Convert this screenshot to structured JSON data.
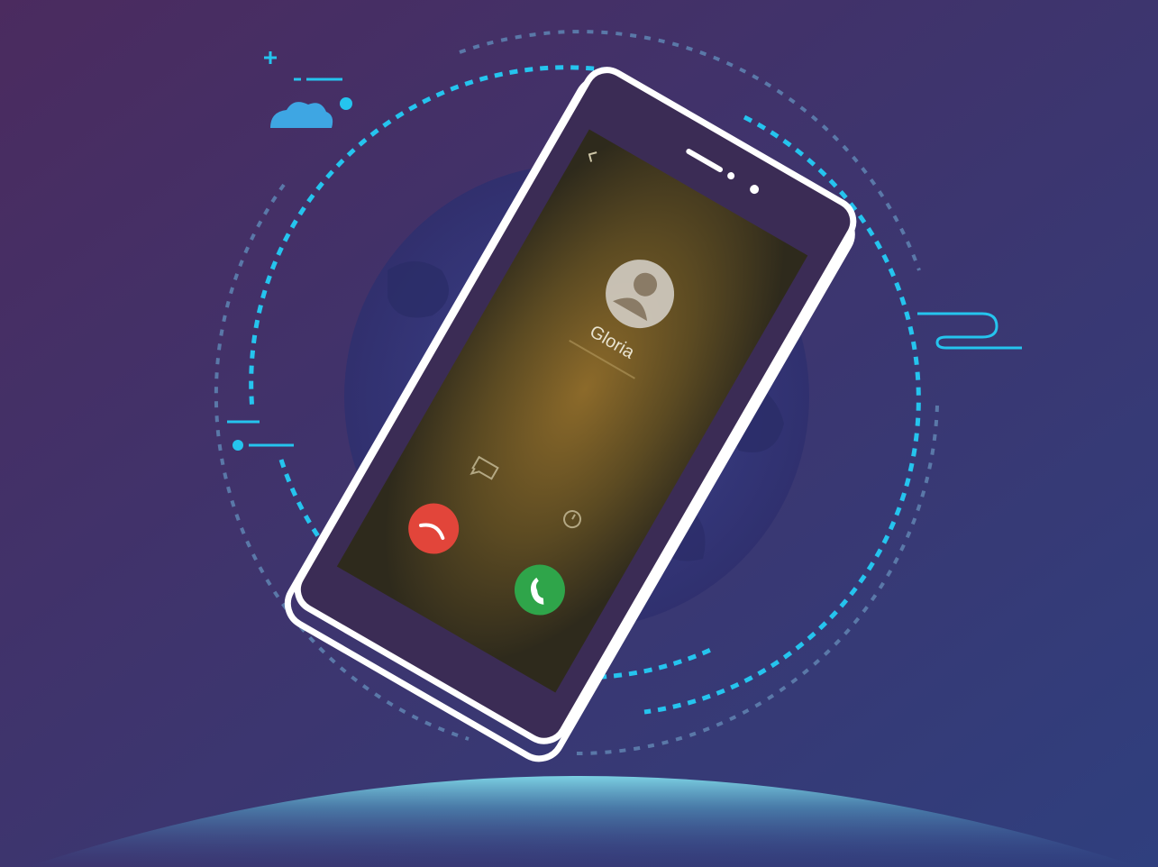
{
  "illustration": {
    "kind": "incoming-call-illustration",
    "caller": {
      "name": "Gloria",
      "avatar_icon": "contact-avatar-icon"
    },
    "actions": [
      {
        "name": "decline",
        "icon": "end-call-icon",
        "color": "#e2453a"
      },
      {
        "name": "answer",
        "icon": "phone-icon",
        "color": "#2fa54a"
      },
      {
        "name": "reply-message",
        "icon": "message-icon"
      },
      {
        "name": "remind-me",
        "icon": "alarm-icon"
      }
    ],
    "decor_icons": [
      "cloud-icon",
      "plus-icon",
      "wind-icon",
      "globe-icon"
    ]
  },
  "colors": {
    "background_top_left": "#4b2b5f",
    "background_bottom_right": "#2f3f7e",
    "accent_cyan": "#25c4ee",
    "ring_muted": "#5a78a8",
    "planet_glow": "#7fd8e8",
    "phone_outline": "#ffffff"
  }
}
